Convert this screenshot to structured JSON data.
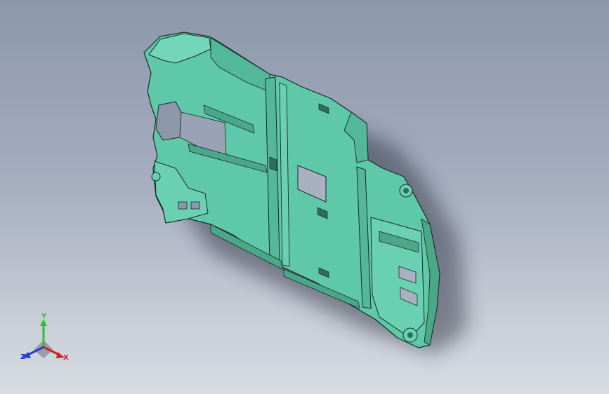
{
  "viewport": {
    "background_top": "#8d97ab",
    "background_bottom": "#d8dbe2"
  },
  "model": {
    "part_color": "#5fc8a9",
    "edge_color": "#1a2a26",
    "shadow_color": "#1c2030"
  },
  "triad": {
    "x_label": "X",
    "y_label": "Y",
    "z_label": "Z",
    "x_color": "#d42020",
    "y_color": "#2fbf2f",
    "z_color": "#1f3fcf"
  }
}
